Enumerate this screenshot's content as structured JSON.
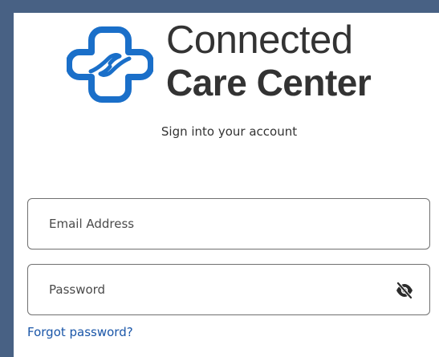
{
  "brand": {
    "name_line1": "Connected",
    "name_line2": "Care Center",
    "icon": "cross-with-hands-icon",
    "color": "#1a6fc9"
  },
  "frame": {
    "border_color": "#486184"
  },
  "login": {
    "subtitle": "Sign into your account",
    "email_placeholder": "Email Address",
    "password_placeholder": "Password",
    "password_toggle_icon": "eye-slash-icon",
    "forgot_password": "Forgot password?"
  }
}
